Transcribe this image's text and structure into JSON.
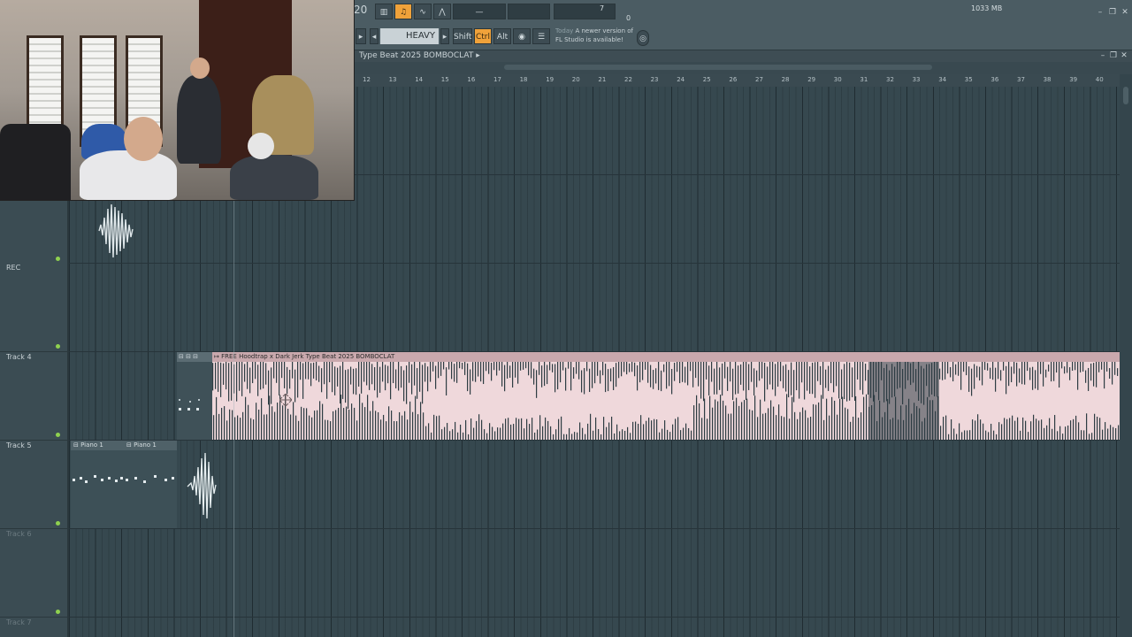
{
  "toolbar": {
    "bpm_digits": "20",
    "mode_label": "HEAVY",
    "mode_prev": "◂",
    "mode_next": "▸",
    "buttons": [
      {
        "label": "Shift"
      },
      {
        "label": "Ctrl"
      },
      {
        "label": "Alt"
      }
    ],
    "cpu_value": "7",
    "memory": "1033 MB",
    "polyphony": "0",
    "news_today": "Today",
    "news_text": "A newer version of FL Studio is available!",
    "news_line1": "A newer version of",
    "news_line2": "FL Studio is available!",
    "win_minimize": "–",
    "win_restore": "❐",
    "win_close": "✕"
  },
  "playlist": {
    "title": "Type Beat 2025 BOMBOCLAT",
    "title_arrow": "▸",
    "ruler": [
      "12",
      "13",
      "14",
      "15",
      "16",
      "17",
      "18",
      "19",
      "20",
      "21",
      "22",
      "23",
      "24",
      "25",
      "26",
      "27",
      "28",
      "29",
      "30",
      "31",
      "32",
      "33",
      "34",
      "35",
      "36",
      "37",
      "38",
      "39",
      "40"
    ]
  },
  "tracks": [
    {
      "label": "REC",
      "dim": false
    },
    {
      "label": "Track 4",
      "dim": false
    },
    {
      "label": "Track 5",
      "dim": false
    },
    {
      "label": "Track 6",
      "dim": true
    },
    {
      "label": "Track 7",
      "dim": true
    }
  ],
  "clips": {
    "main_audio": "FREE Hoodtrap x Dark Jerk Type Beat 2025 BOMBOCLAT",
    "pattern_a": "Piano 1",
    "pattern_b": "Piano 1"
  },
  "colors": {
    "accent": "#f0a23a",
    "clip_audio": "#efd8db",
    "clip_audio_header": "#c9a8ad",
    "waveform": "#2e3d43",
    "led": "#8fd14f"
  }
}
